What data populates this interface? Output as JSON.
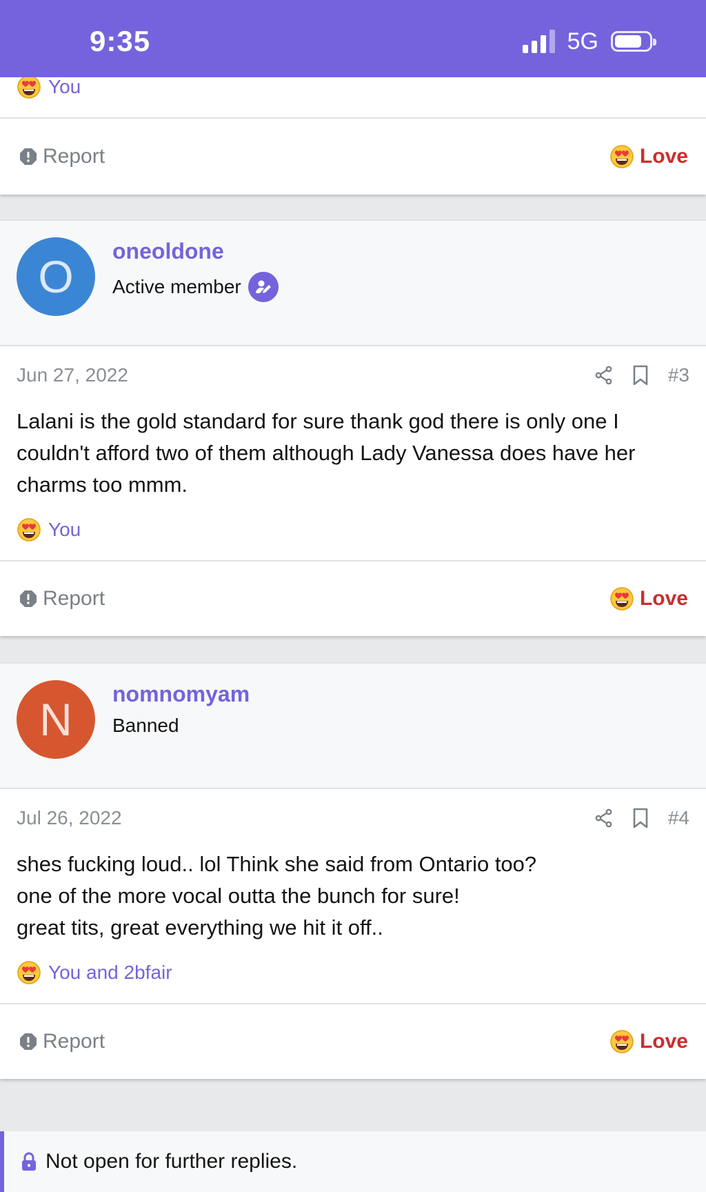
{
  "status_bar": {
    "time": "9:35",
    "network": "5G",
    "battery_level": 0.75,
    "signal_bars": 3
  },
  "colors": {
    "accent": "#7463dc",
    "love": "#cc2d2d",
    "avatar_o": "#3b86d4",
    "avatar_n": "#d6572f",
    "muted": "#8a8f95"
  },
  "top_fragment": {
    "reactions": "You",
    "report": "Report",
    "love": "Love"
  },
  "posts": [
    {
      "username": "oneoldone",
      "user_title": "Active member",
      "avatar_letter": "O",
      "date": "Jun 27, 2022",
      "post_number": "#3",
      "body_lines": [
        "Lalani is the gold standard for sure thank god there is only one I",
        "couldn't afford two of them although Lady Vanessa does have her",
        "charms too mmm."
      ],
      "reactions": "You",
      "report": "Report",
      "love": "Love"
    },
    {
      "username": "nomnomyam",
      "user_title": "Banned",
      "avatar_letter": "N",
      "date": "Jul 26, 2022",
      "post_number": "#4",
      "body_lines": [
        "shes fucking loud.. lol Think she said from Ontario too?",
        "one of the more vocal outta the bunch for sure!",
        "great tits, great everything we hit it off.."
      ],
      "reactions": "You and 2bfair",
      "report": "Report",
      "love": "Love"
    }
  ],
  "thread_status": "Not open for further replies.",
  "icons": [
    "signal-icon",
    "battery-icon",
    "heart-eyes-emoji-icon",
    "report-icon",
    "share-icon",
    "bookmark-icon",
    "badge-edit-icon",
    "lock-icon"
  ]
}
